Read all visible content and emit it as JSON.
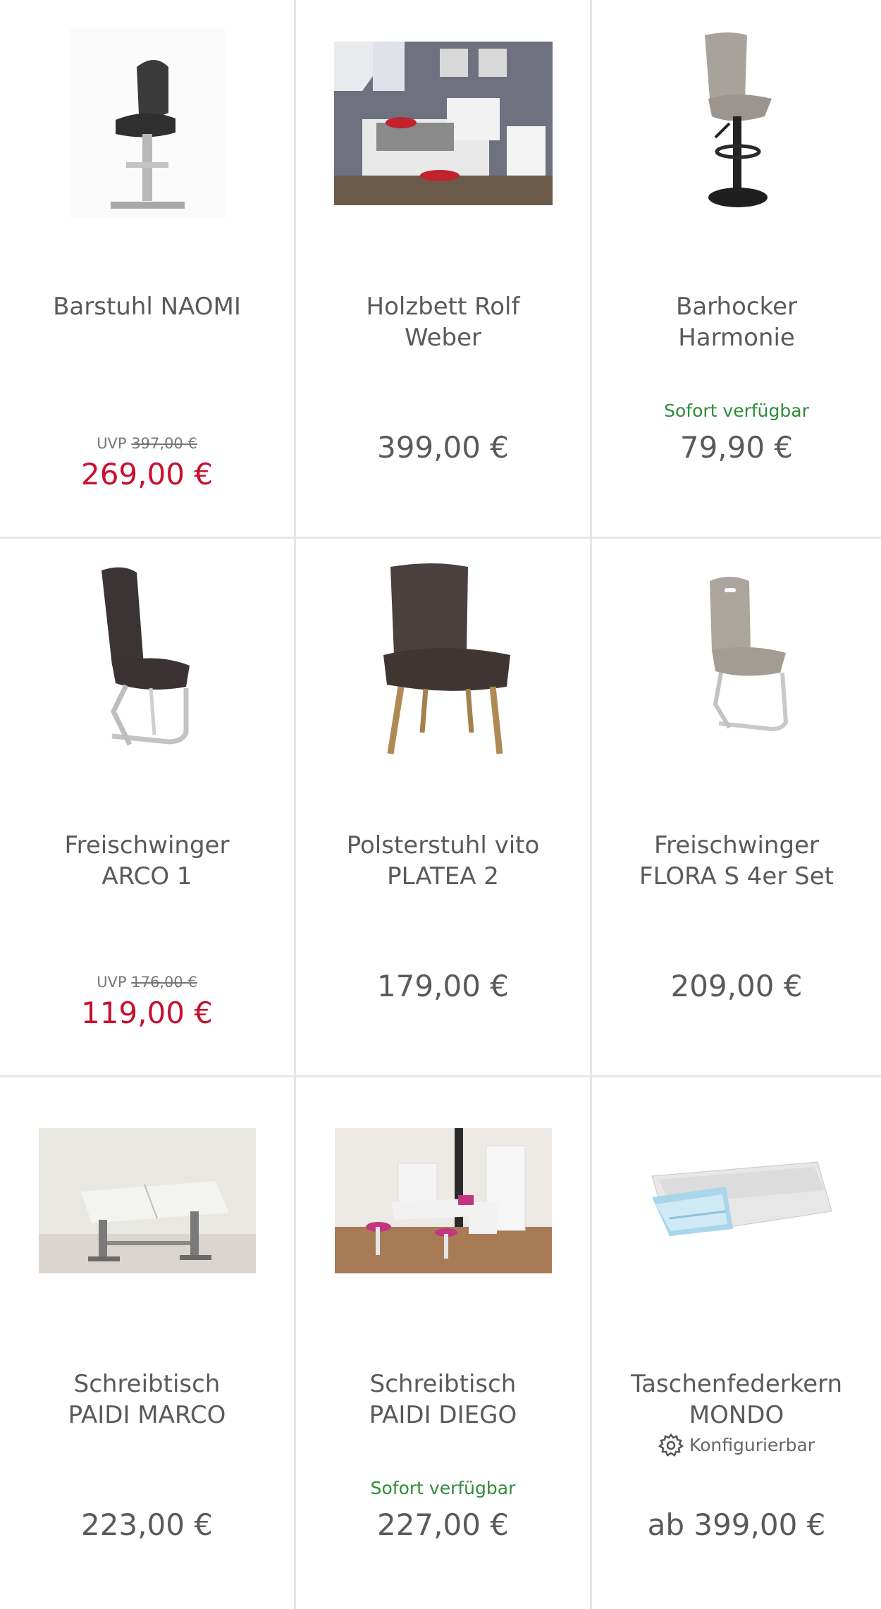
{
  "products": [
    {
      "title": "Barstuhl NAOMI",
      "image_icon": "bar-stool-icon",
      "uvp_label": "UVP",
      "uvp_price": "397,00 €",
      "price": "269,00 €",
      "availability": "",
      "config_label": ""
    },
    {
      "title": "Holzbett Rolf\nWeber",
      "image_icon": "bedroom-photo-icon",
      "uvp_label": "",
      "uvp_price": "",
      "price": "399,00 €",
      "availability": "",
      "config_label": ""
    },
    {
      "title": "Barhocker\nHarmonie",
      "image_icon": "bar-stool-icon",
      "uvp_label": "",
      "uvp_price": "",
      "price": "79,90 €",
      "availability": "Sofort verfügbar",
      "config_label": ""
    },
    {
      "title": "Freischwinger\nARCO 1",
      "image_icon": "cantilever-chair-icon",
      "uvp_label": "UVP",
      "uvp_price": "176,00 €",
      "price": "119,00 €",
      "availability": "",
      "config_label": ""
    },
    {
      "title": "Polsterstuhl vito\nPLATEA 2",
      "image_icon": "upholstered-chair-icon",
      "uvp_label": "",
      "uvp_price": "",
      "price": "179,00 €",
      "availability": "",
      "config_label": ""
    },
    {
      "title": "Freischwinger\nFLORA S 4er Set",
      "image_icon": "cantilever-chair-icon",
      "uvp_label": "",
      "uvp_price": "",
      "price": "209,00 €",
      "availability": "",
      "config_label": ""
    },
    {
      "title": "Schreibtisch\nPAIDI MARCO",
      "image_icon": "desk-photo-icon",
      "uvp_label": "",
      "uvp_price": "",
      "price": "223,00 €",
      "availability": "",
      "config_label": ""
    },
    {
      "title": "Schreibtisch\nPAIDI DIEGO",
      "image_icon": "kids-room-photo-icon",
      "uvp_label": "",
      "uvp_price": "",
      "price": "227,00 €",
      "availability": "Sofort verfügbar",
      "config_label": ""
    },
    {
      "title": "Taschenfederkern\nMONDO",
      "image_icon": "mattress-icon",
      "uvp_label": "",
      "uvp_price": "",
      "price": "ab 399,00 €",
      "availability": "",
      "config_label": "Konfigurierbar"
    }
  ],
  "colors": {
    "sale_price": "#c8102e",
    "availability": "#2e8b3a",
    "text": "#5a5a5a",
    "divider": "#e6e6e6"
  }
}
